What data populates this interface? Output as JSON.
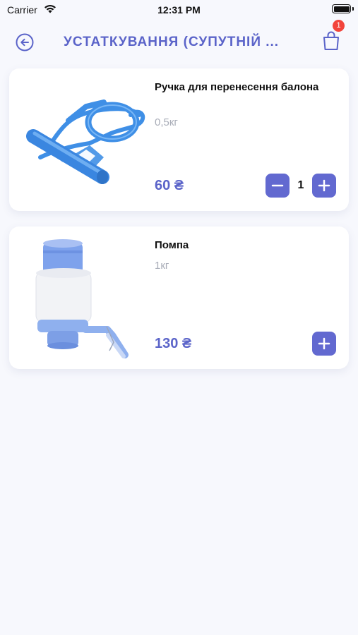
{
  "status_bar": {
    "carrier": "Carrier",
    "time": "12:31 PM"
  },
  "header": {
    "title": "УСТАТКУВАННЯ (СУПУТНІЙ ...",
    "cart_count": "1"
  },
  "products": [
    {
      "name": "Ручка для перенесення балона",
      "weight": "0,5кг",
      "price": "60 ₴",
      "quantity": "1"
    },
    {
      "name": "Помпа",
      "weight": "1кг",
      "price": "130 ₴"
    }
  ],
  "colors": {
    "accent": "#5b64c9",
    "button": "#6269d0",
    "badge": "#f2443b",
    "background": "#f7f8fd"
  },
  "icons": {
    "back": "arrow-left-circle-icon",
    "cart": "shopping-bag-icon",
    "minus": "minus-icon",
    "plus": "plus-icon"
  }
}
